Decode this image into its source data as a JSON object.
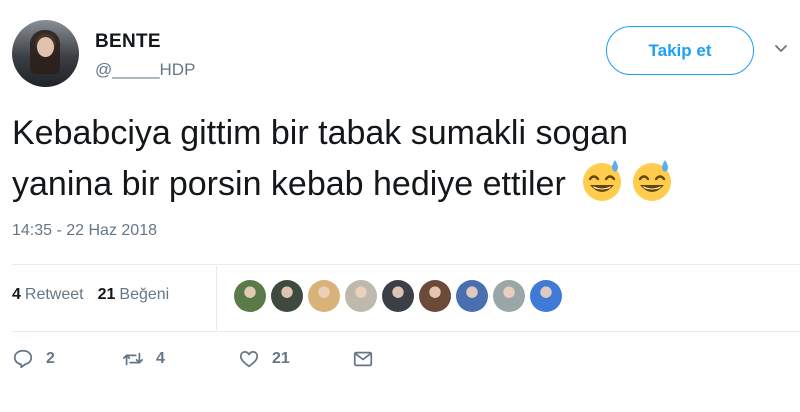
{
  "user": {
    "display_name": "BENTE",
    "handle": "@_____HDP"
  },
  "follow_button": {
    "label": "Takip et"
  },
  "tweet": {
    "line1": "Kebabciya gittim bir tabak sumakli sogan",
    "line2": "yanina bir porsin kebab hediye ettiler",
    "timestamp": "14:35 - 22 Haz 2018"
  },
  "stats": {
    "retweet_count": "4",
    "retweet_label": "Retweet",
    "like_count": "21",
    "like_label": "Beğeni"
  },
  "liker_avatars": [
    "#5b7a4a",
    "#3e4a3f",
    "#d9b27a",
    "#bfb9ad",
    "#3a3f48",
    "#6b4a3a",
    "#4a6fb0",
    "#9aa6a8",
    "#3f7ad6"
  ],
  "actions": {
    "reply_count": "2",
    "retweet_count": "4",
    "like_count": "21"
  },
  "colors": {
    "accent": "#1da1f2",
    "muted": "#657786",
    "divider": "#e6ecf0"
  },
  "icons": [
    "chevron-down-icon",
    "smiling-sweat-emoji-icon",
    "reply-icon",
    "retweet-icon",
    "heart-icon",
    "message-icon"
  ]
}
